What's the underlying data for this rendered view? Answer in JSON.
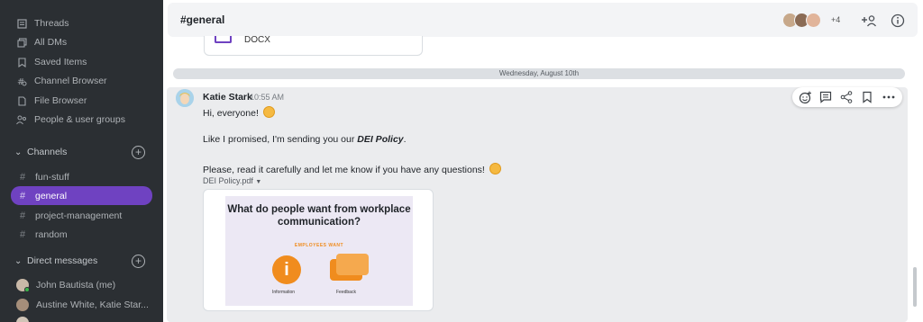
{
  "sidebar": {
    "nav": [
      {
        "label": "Threads",
        "icon": "threads-icon"
      },
      {
        "label": "All DMs",
        "icon": "all-dms-icon"
      },
      {
        "label": "Saved Items",
        "icon": "bookmark-icon"
      },
      {
        "label": "Channel Browser",
        "icon": "channel-browser-icon"
      },
      {
        "label": "File Browser",
        "icon": "file-browser-icon"
      },
      {
        "label": "People & user groups",
        "icon": "people-icon"
      }
    ],
    "channels_header": "Channels",
    "channels": [
      {
        "label": "fun-stuff",
        "active": false
      },
      {
        "label": "general",
        "active": true
      },
      {
        "label": "project-management",
        "active": false
      },
      {
        "label": "random",
        "active": false
      }
    ],
    "dm_header": "Direct messages",
    "dms": [
      {
        "label": "John Bautista (me)"
      },
      {
        "label": "Austine White, Katie Star..."
      }
    ],
    "accent_color": "#6f42c1"
  },
  "header": {
    "title": "#general",
    "member_more": "+4"
  },
  "chat": {
    "prev_file_name": "DOCX",
    "date_divider": "Wednesday, August 10th",
    "message": {
      "author": "Katie Stark",
      "time": "10:55 AM",
      "line1": "Hi, everyone!",
      "line2_prefix": "Like I promised, I'm sending you our ",
      "line2_bold": "DEI Policy",
      "line2_suffix": ".",
      "line3": "Please, read it carefully and let me know if you have any questions!",
      "attachment_name": "DEI Policy.pdf",
      "preview_title": "What do people want from workplace communication?",
      "preview_subtitle": "EMPLOYEES WANT",
      "preview_caption_1": "Information",
      "preview_caption_2": "Feedback"
    }
  }
}
